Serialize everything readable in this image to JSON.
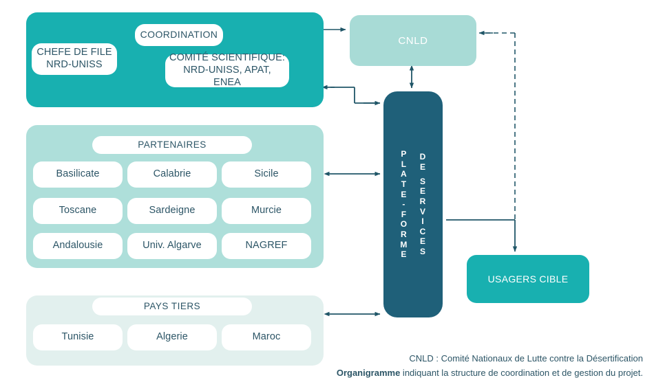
{
  "diagram": {
    "coordination": {
      "title": "COORDINATION",
      "lead": "CHEFE DE FILE\nNRD-UNISS",
      "lead_line1": "CHEFE DE FILE",
      "lead_line2": "NRD-UNISS",
      "committee_line1": "COMITÉ SCIENTIFIQUE:",
      "committee_line2": "NRD-UNISS, APAT, ENEA"
    },
    "partners": {
      "label": "PARTENAIRES",
      "items": [
        "Basilicate",
        "Calabrie",
        "Sicile",
        "Toscane",
        "Sardeigne",
        "Murcie",
        "Andalousie",
        "Univ. Algarve",
        "NAGREF"
      ]
    },
    "third_countries": {
      "label": "PAYS TIERS",
      "items": [
        "Tunisie",
        "Algerie",
        "Maroc"
      ]
    },
    "cnld": {
      "label": "CNLD"
    },
    "platform": {
      "left_column": "PLATE-FORME",
      "right_column": "DE SERVICES"
    },
    "target_users": {
      "label": "USAGERS CIBLE"
    }
  },
  "caption": {
    "line1": "CNLD : Comité Nationaux de Lutte contre la Désertification",
    "line2_bold": "Organigramme",
    "line2_rest": " indiquant la structure de  coordination et de gestion du  projet."
  },
  "colors": {
    "teal": "#18b0b0",
    "light_teal": "#aedfda",
    "pale_teal": "#e2f0ee",
    "cnld_teal": "#a8dbd6",
    "dark_teal": "#1f6079",
    "text_dark": "#2c5566",
    "arrow": "#1f5567"
  }
}
